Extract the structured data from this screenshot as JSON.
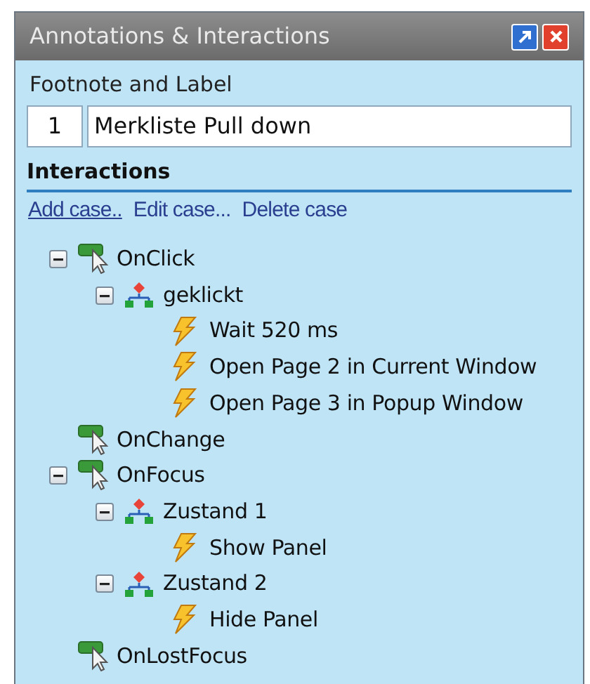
{
  "window": {
    "title": "Annotations & Interactions"
  },
  "footnote": {
    "label": "Footnote and Label",
    "number": "1",
    "value": "Merkliste Pull down"
  },
  "interactions": {
    "heading": "Interactions",
    "links": [
      {
        "label": "Add case..",
        "selected": true
      },
      {
        "label": "Edit case...",
        "selected": false
      },
      {
        "label": "Delete case",
        "selected": false
      }
    ]
  },
  "tree": [
    {
      "kind": "event",
      "label": "OnClick",
      "expanded": true,
      "children": [
        {
          "kind": "case",
          "label": "geklickt",
          "expanded": true,
          "children": [
            {
              "kind": "action",
              "label": "Wait 520 ms"
            },
            {
              "kind": "action",
              "label": "Open Page 2 in Current Window"
            },
            {
              "kind": "action",
              "label": "Open Page 3 in Popup Window"
            }
          ]
        }
      ]
    },
    {
      "kind": "event",
      "label": "OnChange"
    },
    {
      "kind": "event",
      "label": "OnFocus",
      "expanded": true,
      "children": [
        {
          "kind": "case",
          "label": "Zustand 1",
          "expanded": true,
          "children": [
            {
              "kind": "action",
              "label": "Show Panel"
            }
          ]
        },
        {
          "kind": "case",
          "label": "Zustand 2",
          "expanded": true,
          "children": [
            {
              "kind": "action",
              "label": "Hide Panel"
            }
          ]
        }
      ]
    },
    {
      "kind": "event",
      "label": "OnLostFocus"
    }
  ]
}
